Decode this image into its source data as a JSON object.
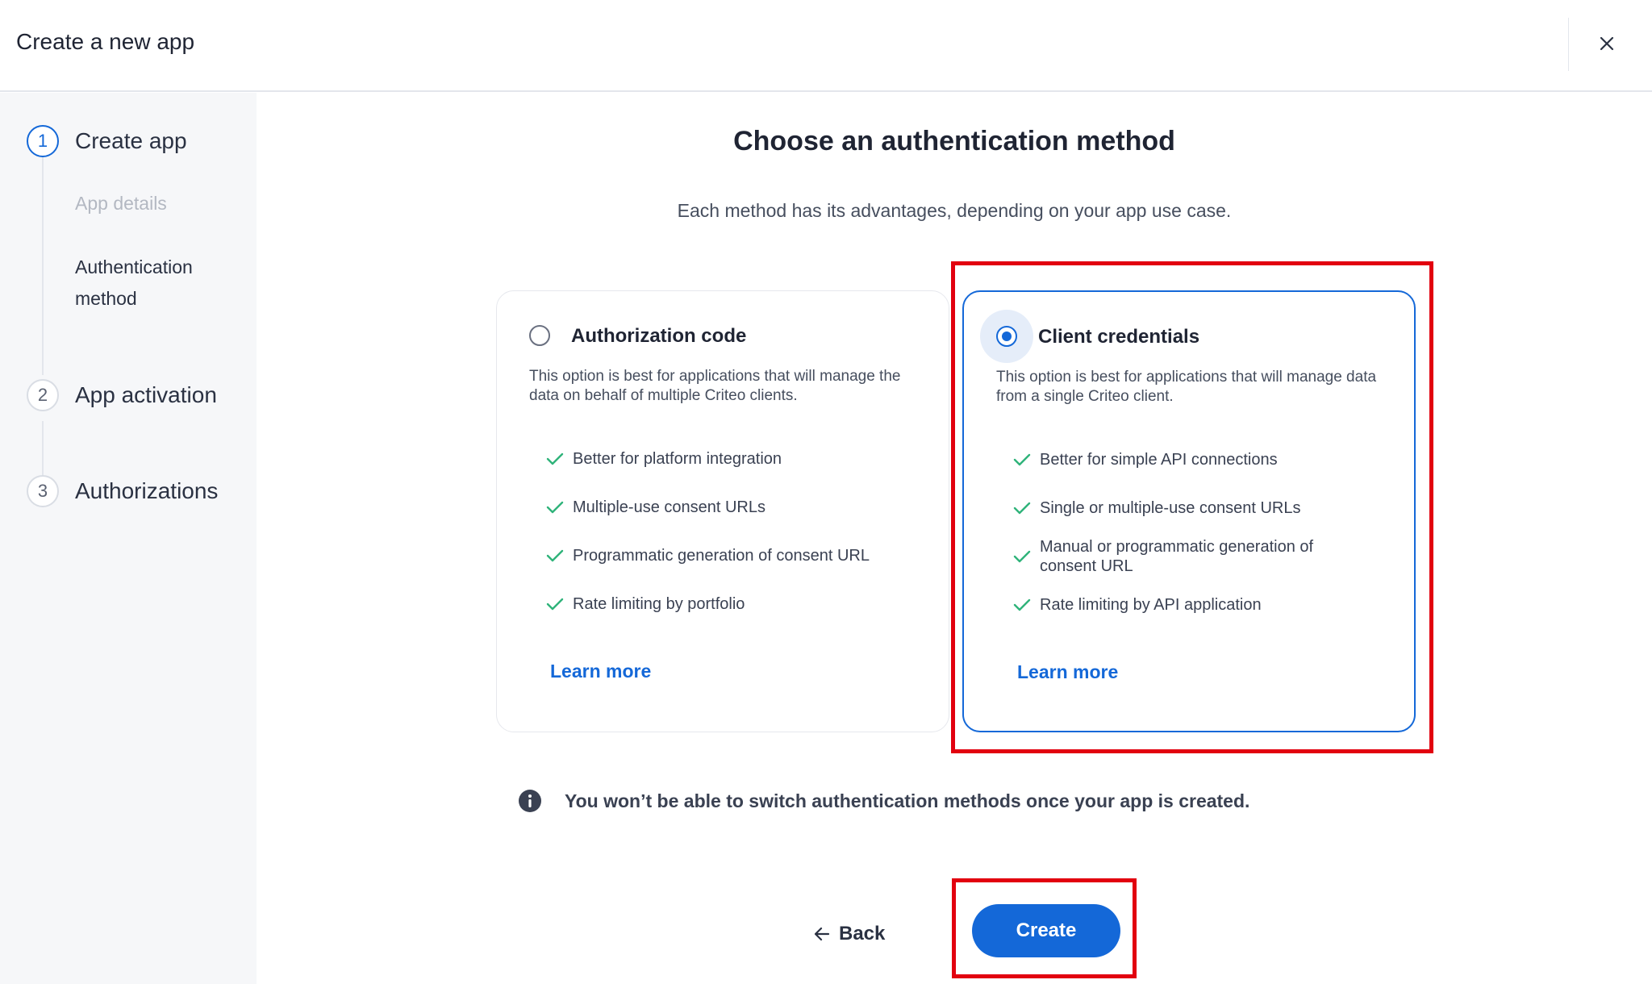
{
  "header": {
    "title": "Create a new app",
    "close_icon": "close-icon"
  },
  "sidebar": {
    "steps": [
      {
        "number": "1",
        "label": "Create app",
        "state": "active",
        "substeps": [
          {
            "label": "App details",
            "state": "done"
          },
          {
            "label": "Authentication method",
            "line1": "Authentication",
            "line2": "method",
            "state": "current"
          }
        ]
      },
      {
        "number": "2",
        "label": "App activation",
        "state": "pending"
      },
      {
        "number": "3",
        "label": "Authorizations",
        "state": "pending"
      }
    ]
  },
  "main": {
    "title": "Choose an authentication method",
    "subtitle": "Each method has its advantages, depending on your app use case.",
    "options": [
      {
        "title": "Authorization code",
        "selected": false,
        "description": "This option is best for applications that will manage the data on behalf of multiple Criteo clients.",
        "features": [
          "Better for platform integration",
          "Multiple-use consent URLs",
          "Programmatic generation of consent URL",
          "Rate limiting by portfolio"
        ],
        "learn_more": "Learn more"
      },
      {
        "title": "Client credentials",
        "selected": true,
        "description": "This option is best for applications that will manage data from a single Criteo client.",
        "features": [
          "Better for simple API connections",
          "Single or multiple-use consent URLs",
          "Manual or programmatic generation of consent URL",
          "Rate limiting by API application"
        ],
        "learn_more": "Learn more"
      }
    ],
    "info_text": "You won’t be able to switch authentication methods once your app is created."
  },
  "footer": {
    "back_label": "Back",
    "create_label": "Create"
  },
  "colors": {
    "accent": "#1468d8",
    "check": "#2fb37a",
    "highlight": "#e2000f",
    "sidebar_bg": "#f6f7f9"
  }
}
